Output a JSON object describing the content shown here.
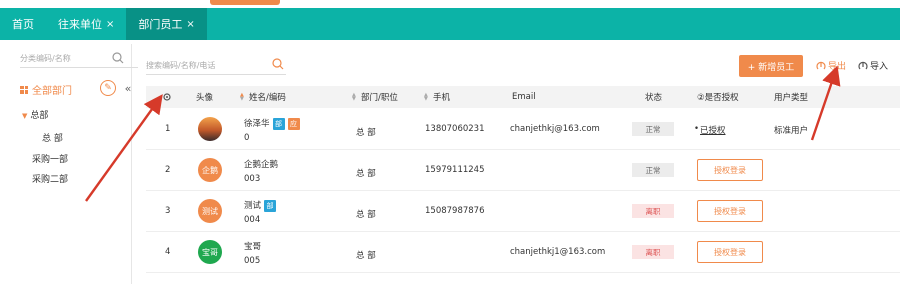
{
  "tabs": [
    {
      "label": "首页",
      "closable": false,
      "active": false
    },
    {
      "label": "往来单位",
      "closable": true,
      "active": false
    },
    {
      "label": "部门员工",
      "closable": true,
      "active": true
    }
  ],
  "close_glyph": "×",
  "sidebar": {
    "search_placeholder": "分类编码/名称",
    "all_label": "全部部门",
    "edit_glyph": "✎",
    "collapse_glyph": "«",
    "tree": [
      {
        "label": "总部",
        "level": 0,
        "expanded": true
      },
      {
        "label": "总 部",
        "level": 1
      },
      {
        "label": "采购一部",
        "level": 0
      },
      {
        "label": "采购二部",
        "level": 0
      }
    ]
  },
  "toolbar": {
    "search_placeholder": "搜索编码/名称/电话",
    "new_label": "+ 新增员工",
    "export_label": "导出",
    "import_label": "导入"
  },
  "table": {
    "headers": {
      "avatar": "头像",
      "name": "姓名/编码",
      "dept": "部门/职位",
      "phone": "手机",
      "email": "Email",
      "status": "状态",
      "auth": "②是否授权",
      "usertype": "用户类型"
    },
    "rows": [
      {
        "index": "1",
        "avatar_text": "",
        "avatar_color": "#c66a2e",
        "name": "徐泽华",
        "code": "0",
        "tags": [
          {
            "text": "部",
            "color": "#2aa4d8"
          },
          {
            "text": "应",
            "color": "#f08a4b"
          }
        ],
        "dept": "总 部",
        "phone": "13807060231",
        "email": "chanjethkj@163.com",
        "status": "正常",
        "status_kind": "normal",
        "auth": "已授权",
        "auth_kind": "authorized",
        "usertype": "标准用户"
      },
      {
        "index": "2",
        "avatar_text": "企鹅",
        "avatar_color": "#f08a4b",
        "name": "企鹅企鹅",
        "code": "003",
        "tags": [],
        "dept": "总 部",
        "phone": "15979111245",
        "email": "",
        "status": "正常",
        "status_kind": "normal",
        "auth": "授权登录",
        "auth_kind": "button",
        "usertype": ""
      },
      {
        "index": "3",
        "avatar_text": "测试",
        "avatar_color": "#f08a4b",
        "name": "测试",
        "code": "004",
        "tags": [
          {
            "text": "部",
            "color": "#2aa4d8"
          }
        ],
        "dept": "总 部",
        "phone": "15087987876",
        "email": "",
        "status": "离职",
        "status_kind": "left",
        "auth": "授权登录",
        "auth_kind": "button",
        "usertype": ""
      },
      {
        "index": "4",
        "avatar_text": "宝哥",
        "avatar_color": "#1fa84f",
        "name": "宝哥",
        "code": "005",
        "tags": [],
        "dept": "总 部",
        "phone": "",
        "email": "chanjethkj1@163.com",
        "status": "离职",
        "status_kind": "left",
        "auth": "授权登录",
        "auth_kind": "button",
        "usertype": ""
      }
    ]
  },
  "colors": {
    "accent": "#f08a4b",
    "teal": "#0cb3a7",
    "arrow": "#d63a2a"
  }
}
